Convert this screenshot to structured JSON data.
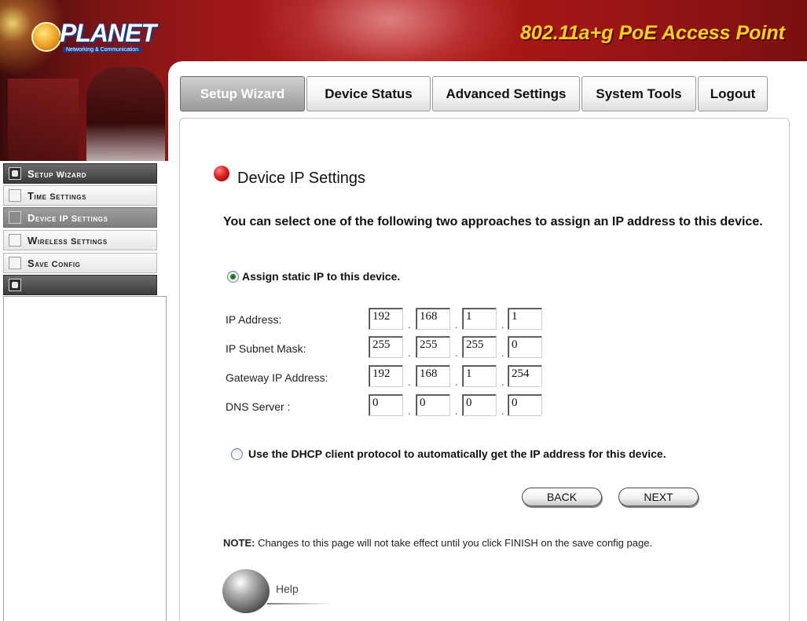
{
  "header": {
    "brand": "PLANET",
    "brand_tagline": "Networking & Communication",
    "product_title": "802.11a+g PoE Access Point"
  },
  "tabs": [
    {
      "label": "Setup Wizard",
      "active": true
    },
    {
      "label": "Device Status",
      "active": false
    },
    {
      "label": "Advanced Settings",
      "active": false
    },
    {
      "label": "System Tools",
      "active": false
    },
    {
      "label": "Logout",
      "active": false
    }
  ],
  "sidebar": {
    "items": [
      {
        "label": "Setup Wizard",
        "state": "header"
      },
      {
        "label": "Time Settings",
        "state": "normal"
      },
      {
        "label": "Device IP Settings",
        "state": "selected"
      },
      {
        "label": "Wireless Settings",
        "state": "normal"
      },
      {
        "label": "Save Config",
        "state": "normal"
      }
    ]
  },
  "main": {
    "heading": "Device IP Settings",
    "intro": "You can select one of the following two approaches to assign an IP address to this device.",
    "static_option": {
      "label": "Assign static IP to this device.",
      "selected": true
    },
    "dhcp_option": {
      "label": "Use the DHCP client protocol to automatically get the IP address for this device.",
      "selected": false
    },
    "fields": {
      "ip_address": {
        "label": "IP Address:",
        "octets": [
          "192",
          "168",
          "1",
          "1"
        ]
      },
      "subnet_mask": {
        "label": "IP Subnet Mask:",
        "octets": [
          "255",
          "255",
          "255",
          "0"
        ]
      },
      "gateway": {
        "label": "Gateway IP Address:",
        "octets": [
          "192",
          "168",
          "1",
          "254"
        ]
      },
      "dns": {
        "label": "DNS Server :",
        "octets": [
          "0",
          "0",
          "0",
          "0"
        ]
      }
    },
    "separator": ".",
    "back_label": "BACK",
    "next_label": "NEXT",
    "note_prefix": "NOTE:",
    "note_text": " Changes to this page will not take effect until you click FINISH on the save config page.",
    "help_label": "Help"
  },
  "colors": {
    "banner_red": "#b21a1a",
    "title_yellow": "#ffd21a",
    "bullet_red": "#e02020",
    "radio_selected": "#1f7a1f"
  }
}
